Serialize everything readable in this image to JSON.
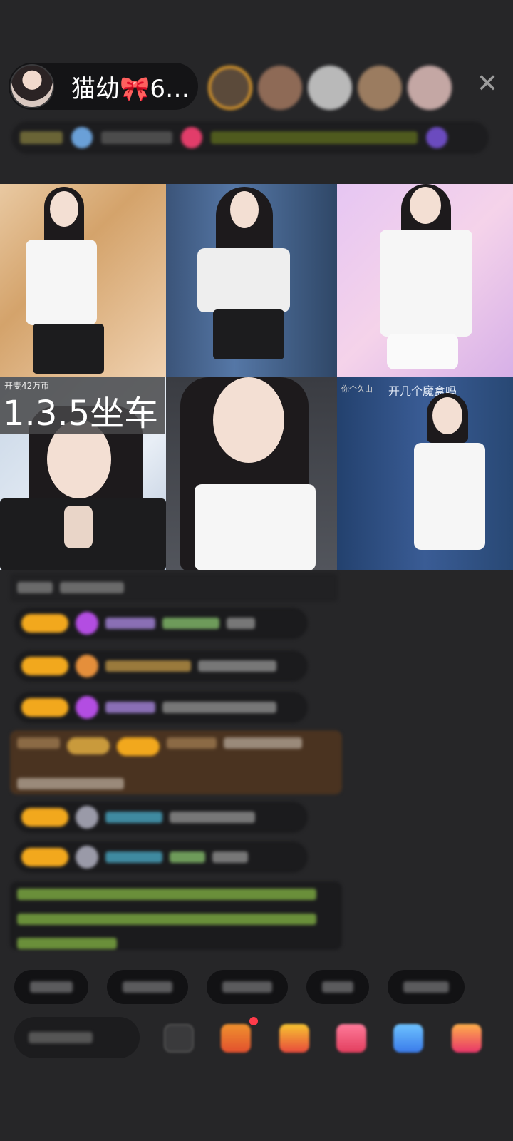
{
  "header": {
    "host_name": "猫幼🎀6…",
    "close_glyph": "✕"
  },
  "grid": {
    "seat_small": "开麦42万币",
    "seat_label": "1.3.5坐车",
    "tile6_caption": "开几个魔盒吗",
    "tile6_caption_left": "你个久山"
  },
  "colors": {
    "background": "#262628",
    "badge_gold": "#f2a81d",
    "gift_bg": "#4a3320",
    "purple_gem": "#b34de2"
  }
}
